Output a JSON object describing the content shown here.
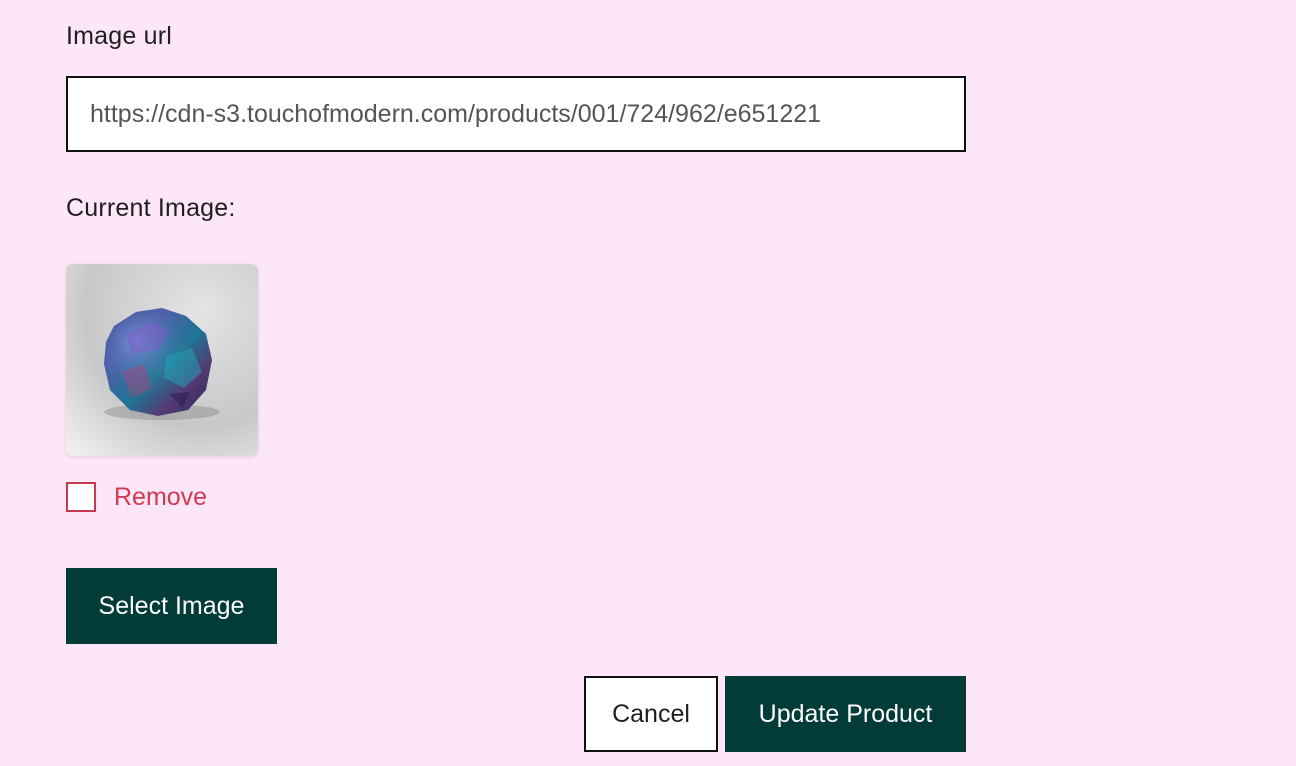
{
  "form": {
    "image_url_label": "Image url",
    "image_url_value": "https://cdn-s3.touchofmodern.com/products/001/724/962/e651221",
    "current_image_label": "Current Image:",
    "remove_label": "Remove",
    "remove_checked": false,
    "select_image_label": "Select Image",
    "cancel_label": "Cancel",
    "update_label": "Update Product"
  },
  "colors": {
    "background": "#fde6f8",
    "primary_button": "#033b38",
    "remove_text": "#d23a52"
  },
  "icons": {
    "thumbnail": "product-image-thumbnail"
  }
}
